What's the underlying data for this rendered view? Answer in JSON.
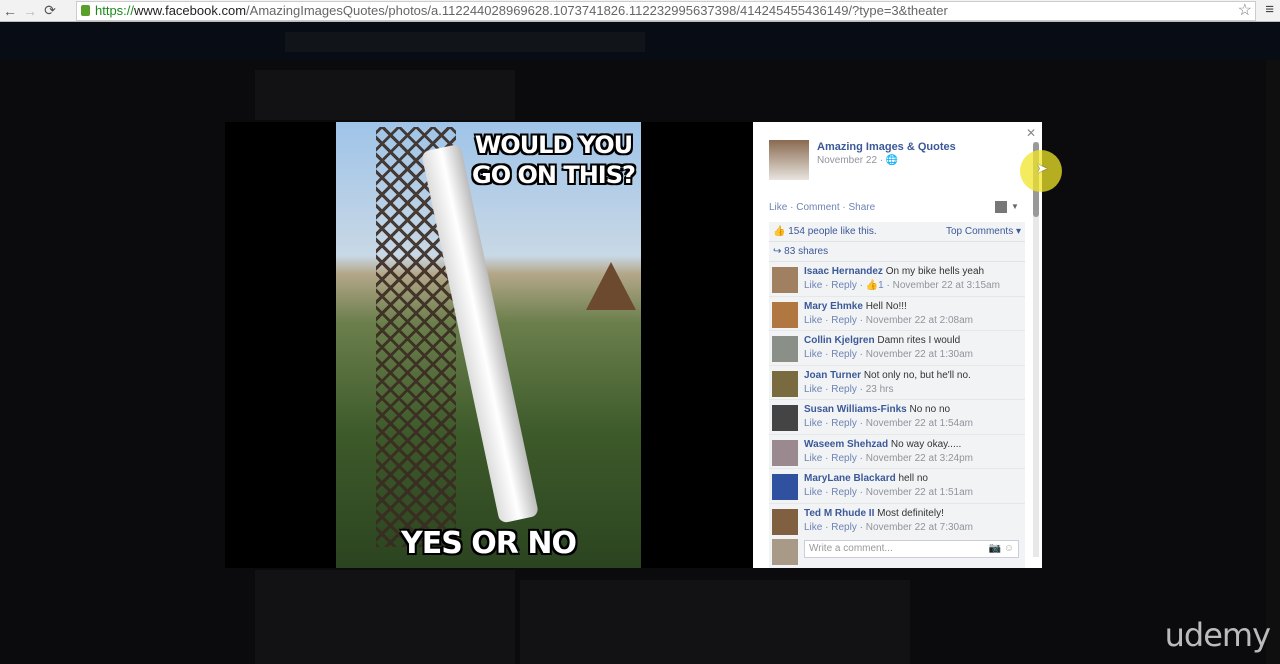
{
  "browser": {
    "url_scheme": "https://",
    "url_host": "www.facebook.com",
    "url_path": "/AmazingImagesQuotes/photos/a.112244028969628.1073741826.112232995637398/414245455436149/?type=3&theater"
  },
  "photo": {
    "top_text": "WOULD YOU GO ON THIS?",
    "bottom_text": "YES OR NO"
  },
  "post": {
    "page_name": "Amazing Images & Quotes",
    "date": "November 22 · ",
    "like": "Like",
    "comment": "Comment",
    "share": "Share",
    "likes_text": "154 people like this.",
    "top_comments": "Top Comments ▾",
    "shares_text": "83 shares"
  },
  "comments": [
    {
      "name": "Isaac Hernandez",
      "text": "On my bike hells yeah",
      "likes": "1",
      "time": "November 22 at 3:15am",
      "avatar": "#a08060"
    },
    {
      "name": "Mary Ehmke",
      "text": "Hell No!!!",
      "time": "November 22 at 2:08am",
      "avatar": "#b07840"
    },
    {
      "name": "Collin Kjelgren",
      "text": "Damn rites I would",
      "time": "November 22 at 1:30am",
      "avatar": "#8a9088"
    },
    {
      "name": "Joan Turner",
      "text": "Not only no, but he'll no.",
      "time": "23 hrs",
      "avatar": "#7a6a40"
    },
    {
      "name": "Susan Williams-Finks",
      "text": "No no no",
      "time": "November 22 at 1:54am",
      "avatar": "#444"
    },
    {
      "name": "Waseem Shehzad",
      "text": "No way okay.....",
      "time": "November 22 at 3:24pm",
      "avatar": "#9a8a90"
    },
    {
      "name": "MaryLane Blackard",
      "text": "hell no",
      "time": "November 22 at 1:51am",
      "avatar": "#3050a0"
    },
    {
      "name": "Ted M Rhude II",
      "text": "Most definitely!",
      "time": "November 22 at 7:30am",
      "avatar": "#806040"
    }
  ],
  "labels": {
    "like": "Like",
    "reply": "Reply"
  },
  "composer": {
    "placeholder": "Write a comment..."
  },
  "watermark": "udemy"
}
